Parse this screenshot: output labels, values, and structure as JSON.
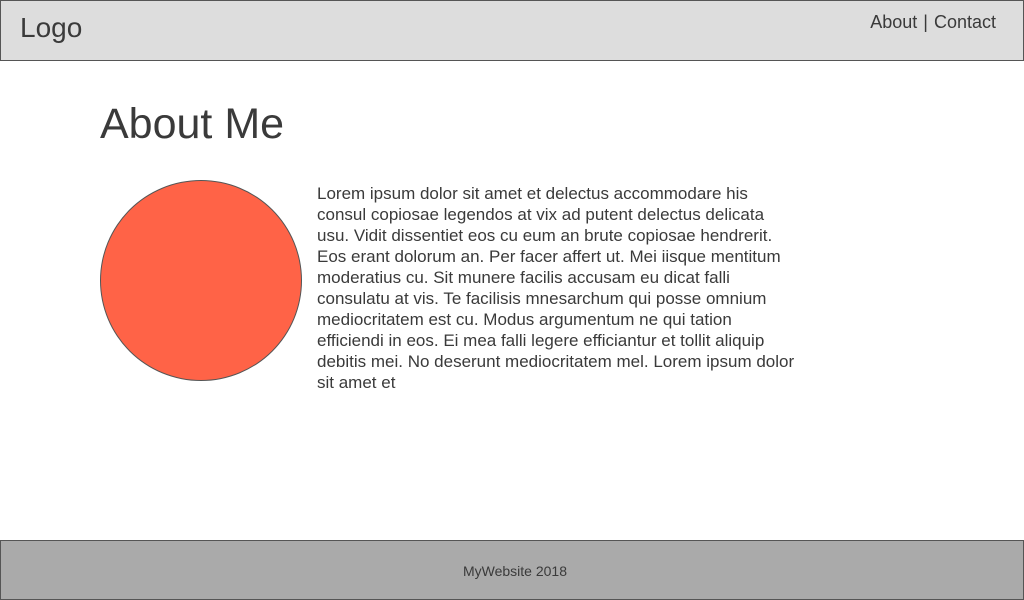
{
  "header": {
    "logo": "Logo",
    "nav": [
      {
        "label": "About"
      },
      {
        "label": "Contact"
      }
    ],
    "separator": "|"
  },
  "main": {
    "title": "About Me",
    "avatar_color": "#ff6347",
    "bio": "Lorem ipsum dolor sit amet et delectus accommodare his consul copiosae legendos at vix ad putent delectus delicata usu. Vidit dissentiet eos cu eum an brute copiosae hendrerit. Eos erant dolorum an. Per facer affert ut. Mei iisque mentitum moderatius cu. Sit munere facilis accusam eu dicat falli consulatu at vis. Te facilisis mnesarchum qui posse omnium mediocritatem est cu. Modus argumentum ne qui tation efficiendi in eos. Ei mea falli legere efficiantur et tollit aliquip debitis mei. No deserunt mediocritatem mel. Lorem ipsum dolor sit amet et"
  },
  "footer": {
    "text": "MyWebsite 2018"
  },
  "colors": {
    "header_bg": "#dddddd",
    "footer_bg": "#aaaaaa",
    "text": "#3a3a3a"
  }
}
